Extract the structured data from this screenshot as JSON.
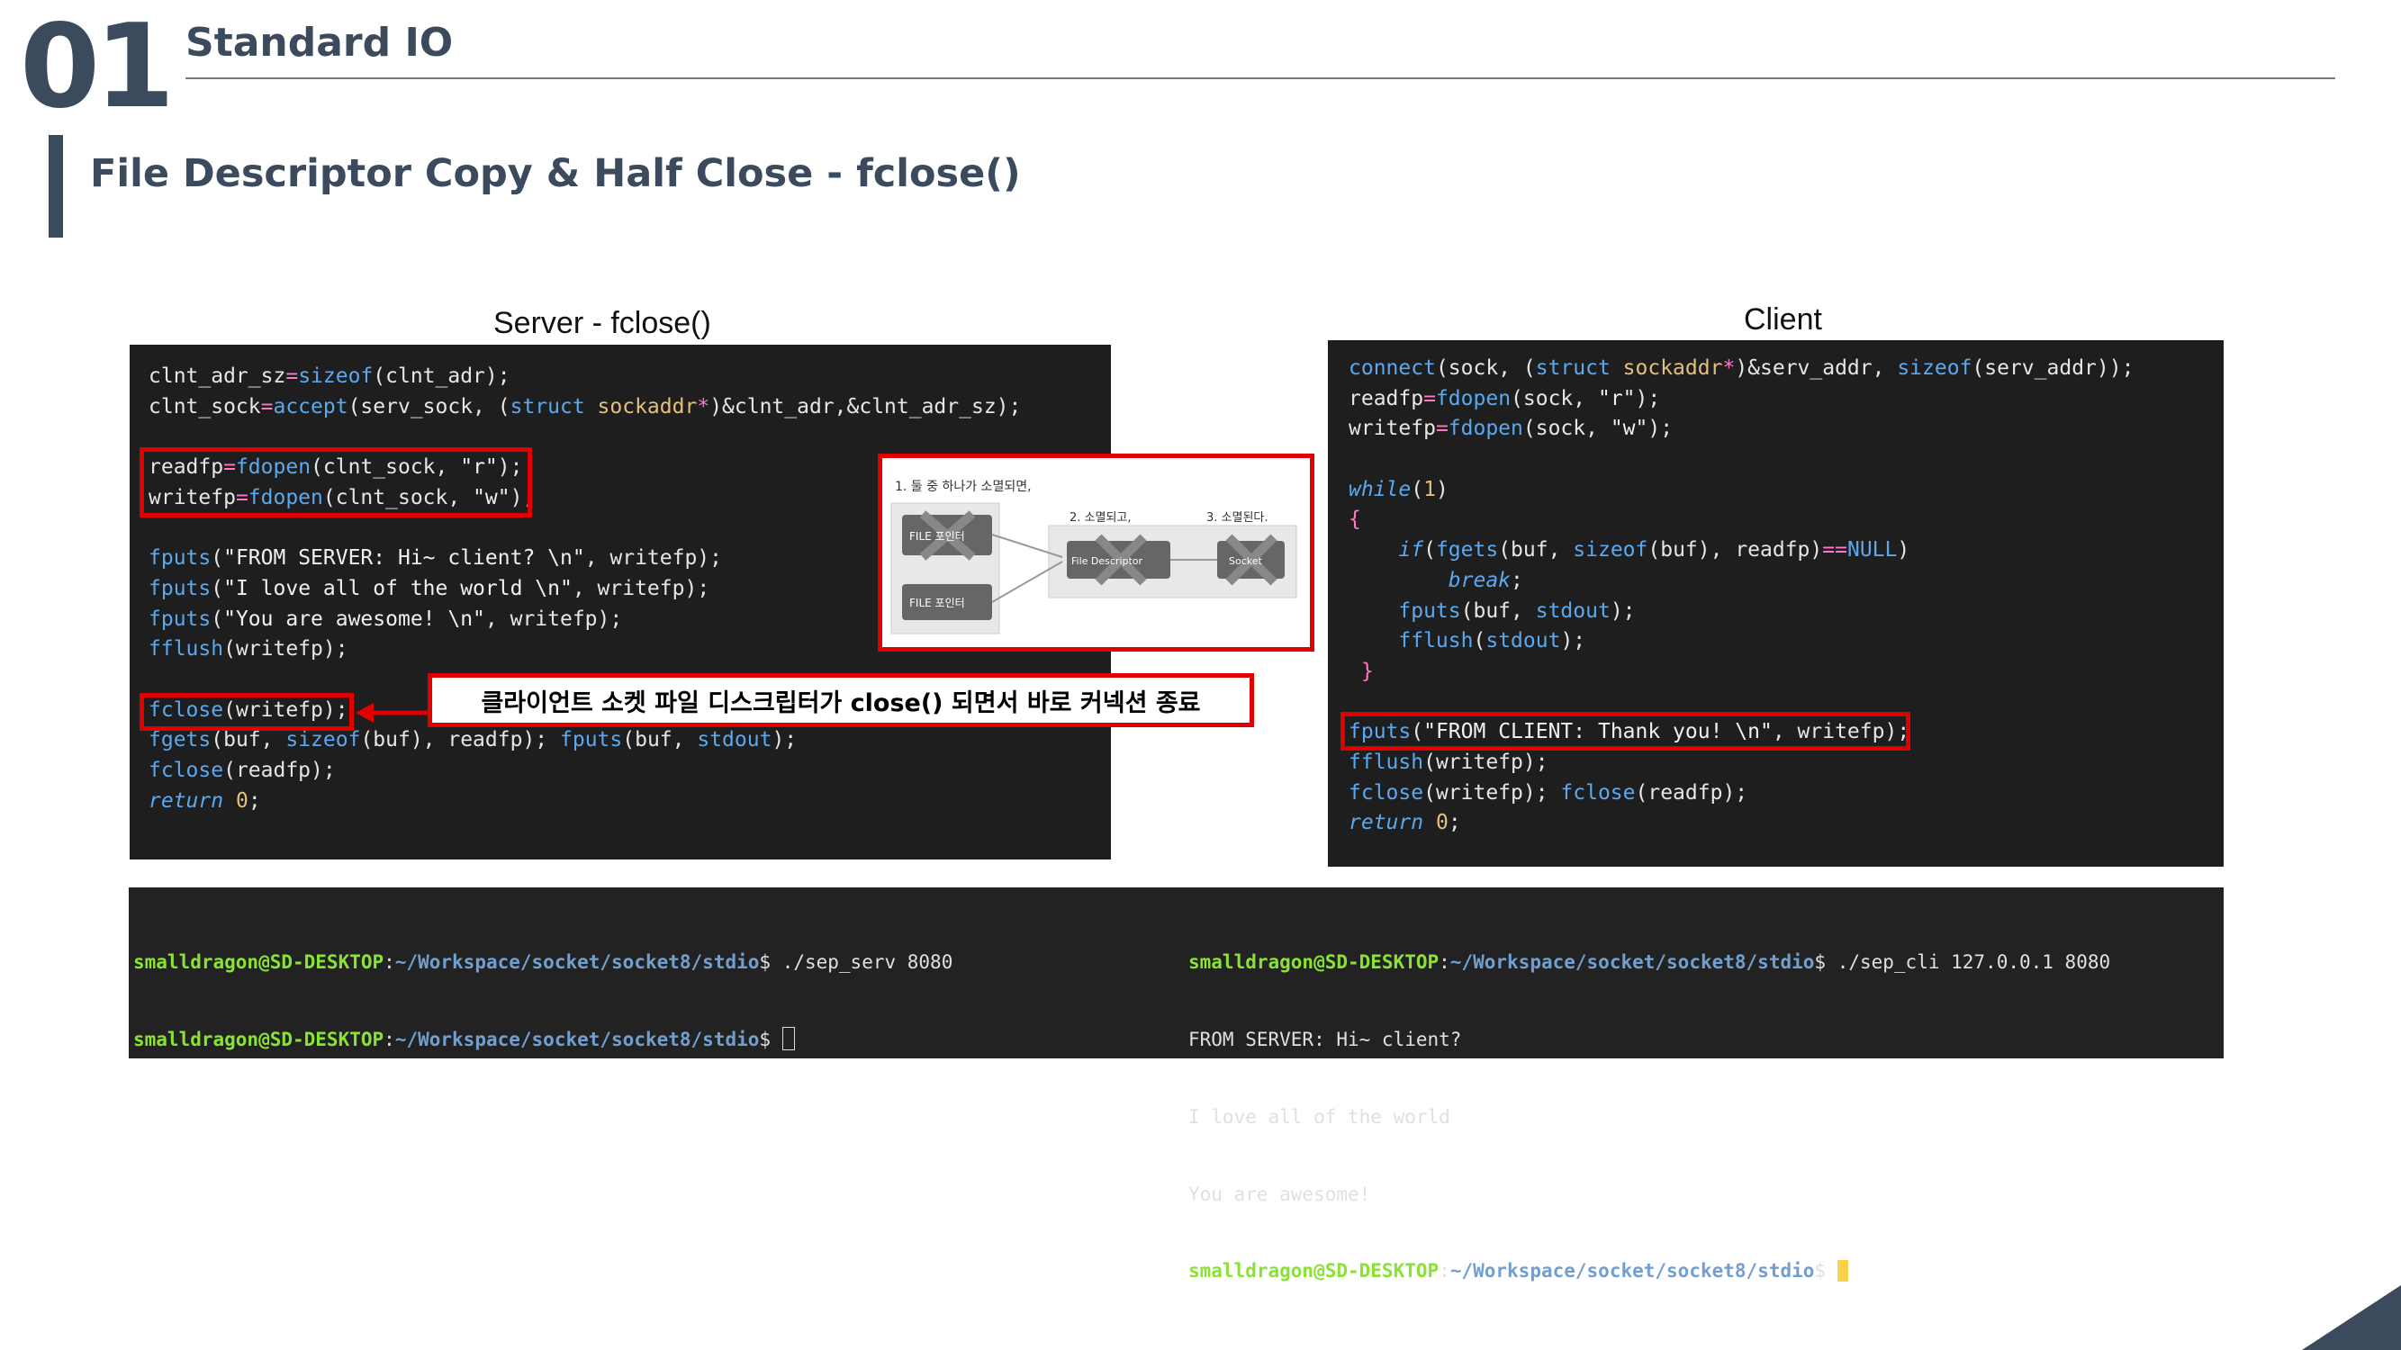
{
  "header": {
    "section_number": "01",
    "section_title": "Standard IO",
    "subtitle": "File Descriptor Copy & Half Close - fclose()"
  },
  "server": {
    "caption": "Server  - fclose()"
  },
  "client": {
    "caption": "Client"
  },
  "callout": {
    "text": "클라이언트 소켓 파일 디스크립터가 close() 되면서 바로 커넥션 종료"
  },
  "diagram": {
    "step1": "1. 둘 중 하나가 소멸되면,",
    "step2": "2. 소멸되고,",
    "step3": "3. 소멸된다.",
    "file_ptr_top": "FILE 포인터",
    "file_ptr_bottom": "FILE 포인터",
    "file_descriptor": "File Descriptor",
    "socket": "Socket"
  },
  "terminal": {
    "server_user": "smalldragon@SD-DESKTOP",
    "server_path": "~/Workspace/socket/socket8/stdio",
    "server_cmd": "./sep_serv 8080",
    "client_user": "smalldragon@SD-DESKTOP",
    "client_path": "~/Workspace/socket/socket8/stdio",
    "client_cmd": "./sep_cli 127.0.0.1 8080",
    "client_output": [
      "FROM SERVER: Hi~ client?",
      "I love all of the world",
      "You are awesome!"
    ]
  }
}
